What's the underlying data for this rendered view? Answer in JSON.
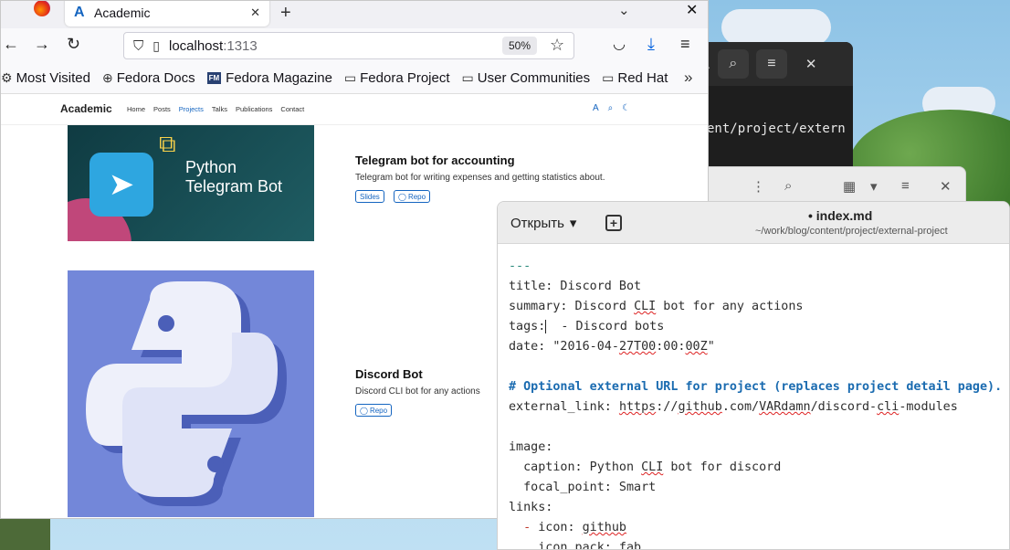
{
  "browser": {
    "tab_title": "Academic",
    "url_host": "localhost",
    "url_port": ":1313",
    "zoom": "50%",
    "bookmarks": [
      "Most Visited",
      "Fedora Docs",
      "Fedora Magazine",
      "Fedora Project",
      "User Communities",
      "Red Hat"
    ]
  },
  "site": {
    "brand": "Academic",
    "menu": [
      "Home",
      "Posts",
      "Projects",
      "Talks",
      "Publications",
      "Contact"
    ],
    "active_menu": "Projects",
    "nav_right_letter": "A"
  },
  "projects": [
    {
      "title": "Telegram bot for accounting",
      "summary": "Telegram bot for writing expenses and getting statistics about.",
      "image_text_line1": "Python",
      "image_text_line2": "Telegram Bot",
      "buttons": [
        "Slides",
        "Repo"
      ]
    },
    {
      "title": "Discord Bot",
      "summary": "Discord CLI bot for any actions",
      "buttons": [
        "Repo"
      ]
    }
  ],
  "terminal": {
    "text": "ent/project/extern"
  },
  "editor": {
    "open_label": "Открыть",
    "file_title": "• index.md",
    "file_path": "~/work/blog/content/project/external-project",
    "lines": {
      "l1": "---",
      "l2a": "title: Discord Bot",
      "l3a": "summary: Discord ",
      "l3b": "CLI",
      "l3c": " bot for any actions",
      "l4a": "tags:",
      "l4b": "  - Discord bots",
      "l5a": "date: \"2016-04-",
      "l5b": "27T00",
      "l5c": ":00:",
      "l5d": "00Z",
      "l5e": "\"",
      "l7": "# Optional external URL for project (replaces project detail page).",
      "l8a": "external_link: ",
      "l8b": "https",
      "l8c": "://",
      "l8d": "github",
      "l8e": ".com/",
      "l8f": "VARdamn",
      "l8g": "/discord-",
      "l8h": "cli",
      "l8i": "-modules",
      "l10": "image:",
      "l11a": "  caption: Python ",
      "l11b": "CLI",
      "l11c": " bot for discord",
      "l12": "  focal_point: Smart",
      "l13": "links:",
      "l14a": "  - ",
      "l14b": "icon: ",
      "l14c": "github",
      "l15": "    icon_pack: fab"
    }
  }
}
